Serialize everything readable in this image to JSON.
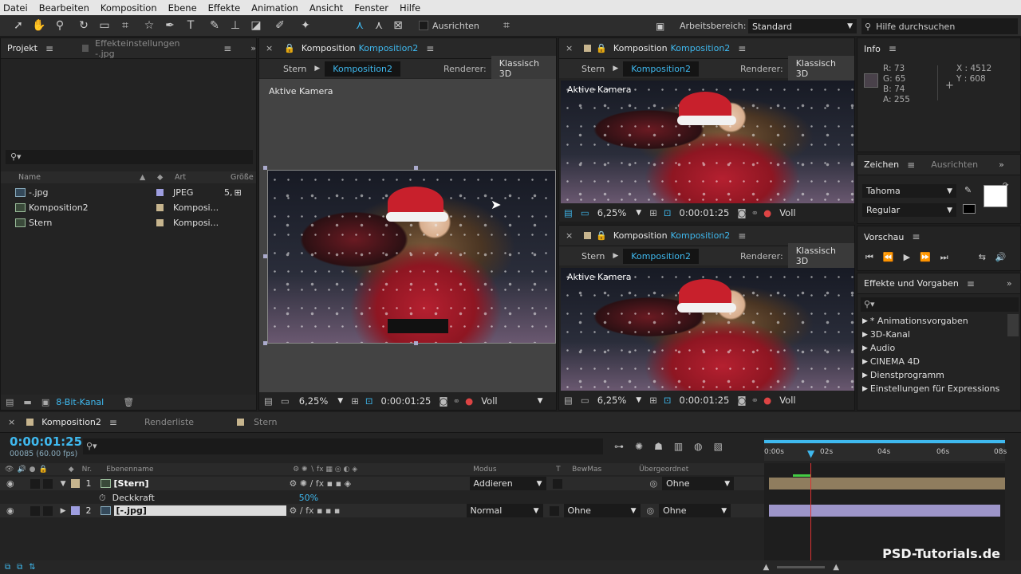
{
  "menu": [
    "Datei",
    "Bearbeiten",
    "Komposition",
    "Ebene",
    "Effekte",
    "Animation",
    "Ansicht",
    "Fenster",
    "Hilfe"
  ],
  "toolbar": {
    "align_label": "Ausrichten",
    "workspace_label": "Arbeitsbereich:",
    "workspace_value": "Standard",
    "help_placeholder": "Hilfe durchsuchen"
  },
  "project": {
    "tab": "Projekt",
    "effect_tab": "Effekteinstellungen -.jpg",
    "cols": {
      "name": "Name",
      "type": "Art",
      "size": "Größe"
    },
    "items": [
      {
        "name": "-.jpg",
        "type": "JPEG",
        "size": "5,"
      },
      {
        "name": "Komposition2",
        "type": "Komposi...",
        "size": ""
      },
      {
        "name": "Stern",
        "type": "Komposi...",
        "size": ""
      }
    ],
    "bitdepth": "8-Bit-Kanal"
  },
  "comp_main": {
    "title": "Komposition",
    "comp": "Komposition2",
    "crumb_parent": "Stern",
    "crumb_active": "Komposition2",
    "renderer_label": "Renderer:",
    "renderer": "Klassisch 3D",
    "camera": "Aktive Kamera",
    "zoom": "6,25%",
    "time": "0:00:01:25",
    "quality": "Voll"
  },
  "comp_top": {
    "title": "Komposition",
    "comp": "Komposition2",
    "crumb_parent": "Stern",
    "crumb_active": "Komposition2",
    "renderer_label": "Renderer:",
    "renderer": "Klassisch 3D",
    "camera": "Aktive Kamera",
    "zoom": "6,25%",
    "time": "0:00:01:25",
    "quality": "Voll"
  },
  "comp_bottom": {
    "title": "Komposition",
    "comp": "Komposition2",
    "crumb_parent": "Stern",
    "crumb_active": "Komposition2",
    "renderer_label": "Renderer:",
    "renderer": "Klassisch 3D",
    "camera": "Aktive Kamera",
    "zoom": "6,25%",
    "time": "0:00:01:25",
    "quality": "Voll"
  },
  "info": {
    "tab": "Info",
    "r": "R: 73",
    "g": "G: 65",
    "b": "B: 74",
    "a": "A: 255",
    "x": "X : 4512",
    "y": "Y : 608",
    "swatch": "#49414a"
  },
  "character": {
    "tab": "Zeichen",
    "tab2": "Ausrichten",
    "font": "Tahoma",
    "style": "Regular"
  },
  "preview": {
    "tab": "Vorschau"
  },
  "effects": {
    "tab": "Effekte und Vorgaben",
    "items": [
      "* Animationsvorgaben",
      "3D-Kanal",
      "Audio",
      "CINEMA 4D",
      "Dienstprogramm",
      "Einstellungen für Expressions"
    ]
  },
  "timeline": {
    "tab_active": "Komposition2",
    "tab_render": "Renderliste",
    "tab_star": "Stern",
    "timecode": "0:00:01:25",
    "frames": "00085 (60.00 fps)",
    "cols": {
      "nr": "Nr.",
      "name": "Ebenenname",
      "mode": "Modus",
      "t": "T",
      "trkmat": "BewMas",
      "parent": "Übergeordnet"
    },
    "ruler": [
      "0:00s",
      "02s",
      "04s",
      "06s",
      "08s"
    ],
    "layers": [
      {
        "nr": "1",
        "name": "[Stern]",
        "mode": "Addieren",
        "trkmat": "",
        "parent": "Ohne"
      },
      {
        "nr": "2",
        "name": "[-.jpg]",
        "mode": "Normal",
        "trkmat": "Ohne",
        "parent": "Ohne"
      }
    ],
    "prop_name": "Deckkraft",
    "prop_value": "50%"
  },
  "watermark": "PSD-Tutorials.de"
}
